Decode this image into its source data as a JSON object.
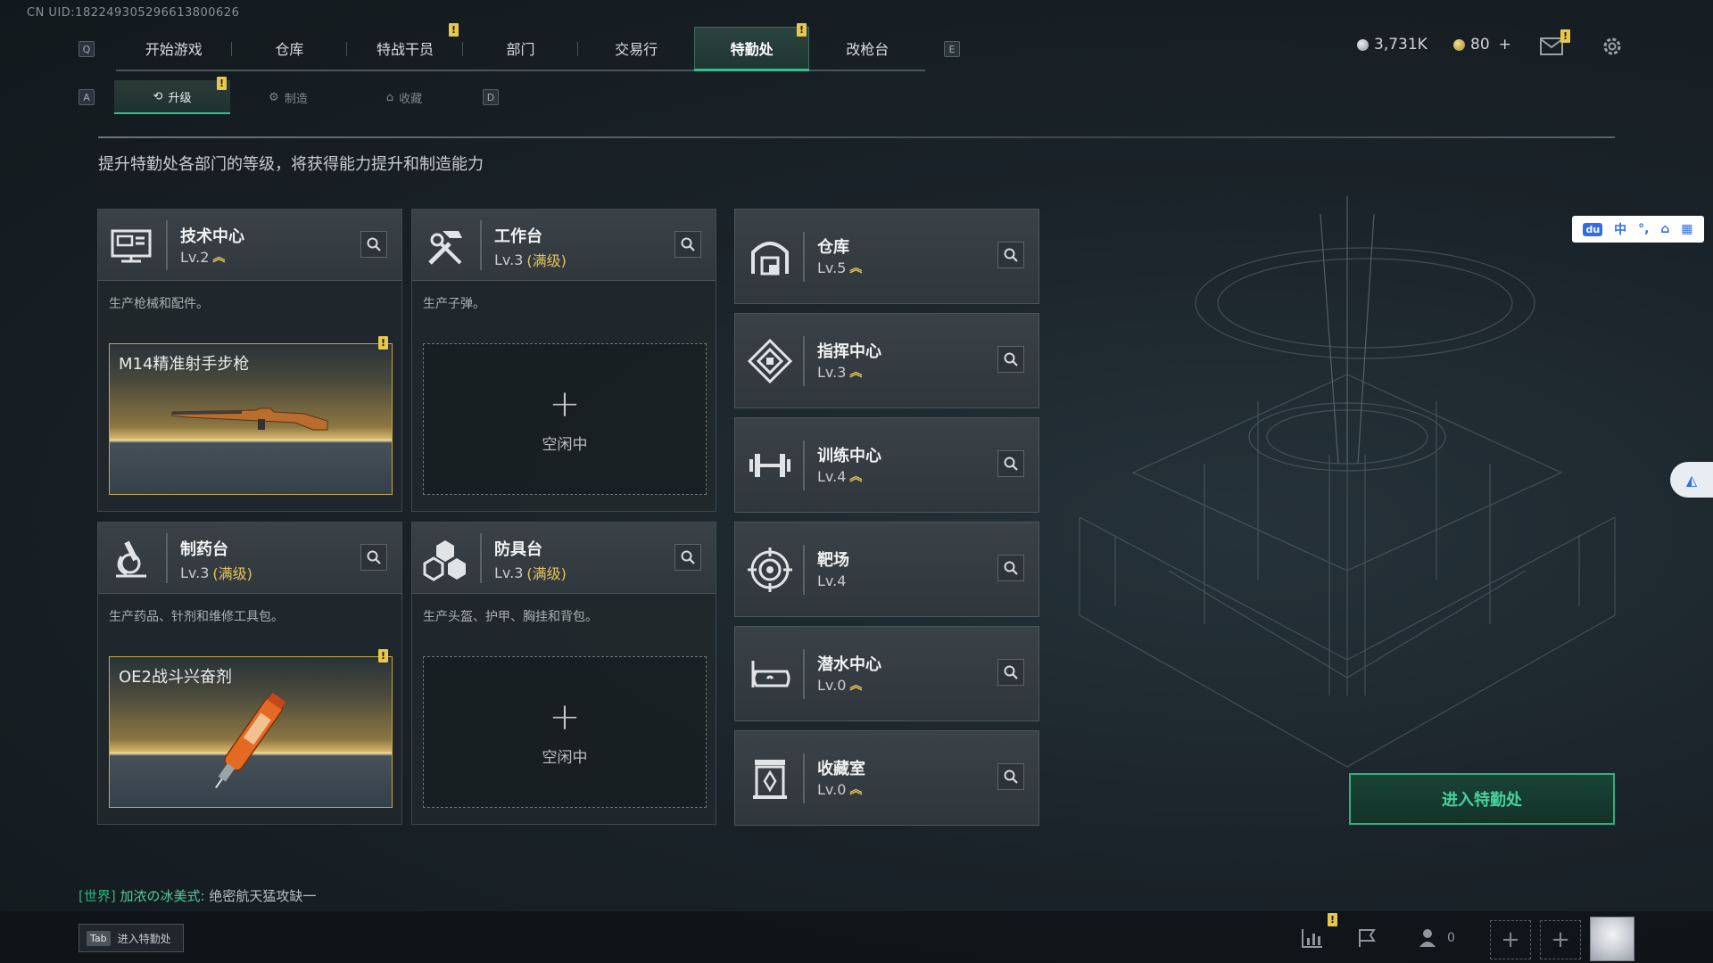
{
  "uid_text": "CN UID:1822493052966138006​26",
  "nav": {
    "key_left": "Q",
    "key_right": "E",
    "tabs": [
      {
        "label": "开始游戏"
      },
      {
        "label": "仓库"
      },
      {
        "label": "特战干员",
        "badge": "!"
      },
      {
        "label": "部门"
      },
      {
        "label": "交易行"
      },
      {
        "label": "特勤处",
        "badge": "!",
        "active": true
      },
      {
        "label": "改枪台"
      }
    ]
  },
  "currency": {
    "coins": "3,731K",
    "tickets": "80",
    "tickets_add": "+"
  },
  "mail_badge": "!",
  "subnav": {
    "key_left": "A",
    "key_right": "D",
    "tabs": [
      {
        "label": "升级",
        "active": true,
        "badge": "!"
      },
      {
        "label": "制造"
      },
      {
        "label": "收藏"
      }
    ]
  },
  "description": "提升特勤处各部门的等级，将获得能力提升和制造能力",
  "departments": [
    {
      "name": "技术中心",
      "level": "Lv.2",
      "upgradable": true,
      "desc": "生产枪械和配件。",
      "product": "M14精准射手步枪",
      "product_badge": "!",
      "icon": "tech-center-icon"
    },
    {
      "name": "工作台",
      "level": "Lv.3",
      "max_label": "(满级)",
      "desc": "生产子弹。",
      "idle_label": "空闲中",
      "icon": "hammer-wrench-icon"
    },
    {
      "name": "制药台",
      "level": "Lv.3",
      "max_label": "(满级)",
      "desc": "生产药品、针剂和维修工具包。",
      "product": "OE2战斗兴奋剂",
      "product_badge": "!",
      "icon": "microscope-icon"
    },
    {
      "name": "防具台",
      "level": "Lv.3",
      "max_label": "(满级)",
      "desc": "生产头盔、护甲、胸挂和背包。",
      "idle_label": "空闲中",
      "icon": "armor-blocks-icon"
    }
  ],
  "facilities": [
    {
      "name": "仓库",
      "level": "Lv.5",
      "upgradable": true,
      "icon": "storage-icon"
    },
    {
      "name": "指挥中心",
      "level": "Lv.3",
      "upgradable": true,
      "icon": "command-center-icon"
    },
    {
      "name": "训练中心",
      "level": "Lv.4",
      "upgradable": true,
      "icon": "dumbbell-icon"
    },
    {
      "name": "靶场",
      "level": "Lv.4",
      "upgradable": false,
      "icon": "target-icon"
    },
    {
      "name": "潜水中心",
      "level": "Lv.0",
      "upgradable": true,
      "icon": "diving-mask-icon"
    },
    {
      "name": "收藏室",
      "level": "Lv.0",
      "upgradable": true,
      "icon": "collection-room-icon"
    }
  ],
  "enter_button": "进入特勤处",
  "chat": {
    "channel": "[世界]",
    "sender": "加浓の冰美式:",
    "message": "绝密航天猛攻缺一"
  },
  "tab_hint": {
    "key": "Tab",
    "label": "进入特勤处"
  },
  "bottom": {
    "stats_badge": "!",
    "friends_count": "0"
  },
  "ime": {
    "zh": "中",
    "punct": "°,"
  },
  "colors": {
    "accent_green": "#2ec28f",
    "badge_yellow": "#e8c74c",
    "maxed_gold": "#e5c35a"
  }
}
